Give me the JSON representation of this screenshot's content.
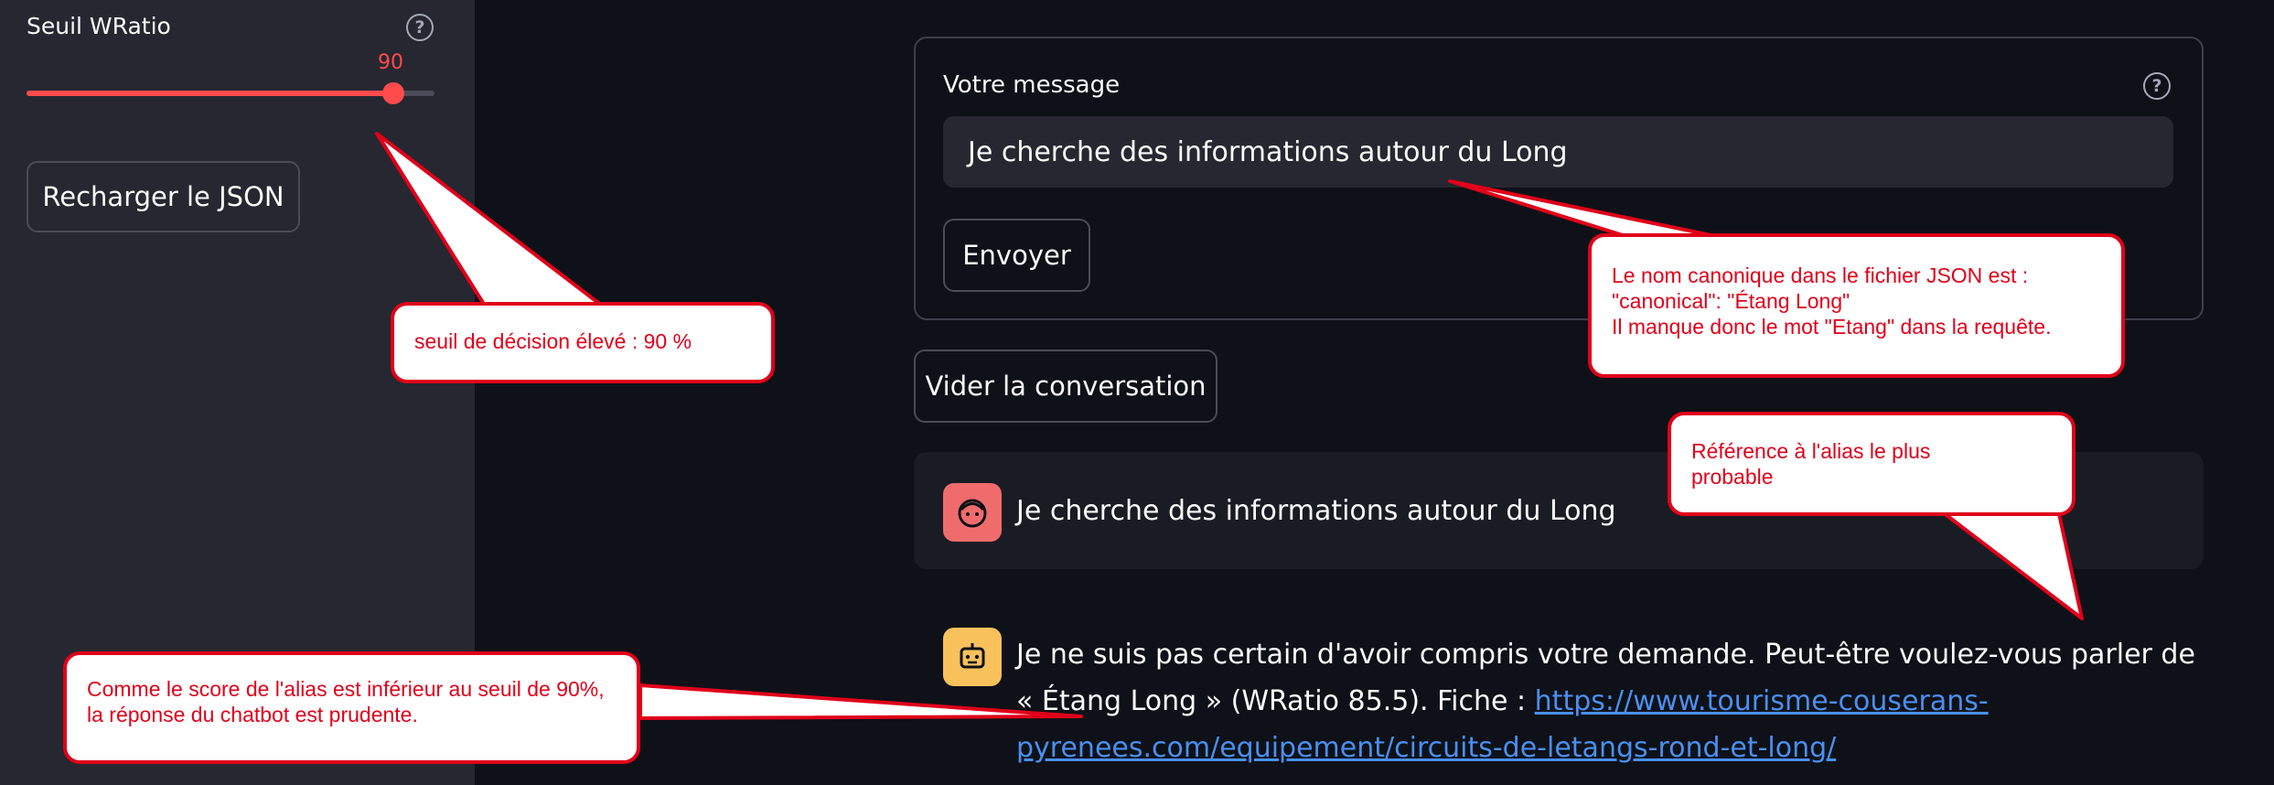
{
  "sidebar": {
    "slider_label": "Seuil WRatio",
    "slider_value": "90",
    "slider_fraction": 0.9,
    "help_glyph": "?",
    "reload_button": "Recharger le JSON"
  },
  "form": {
    "label": "Votre message",
    "help_glyph": "?",
    "input_value": "Je cherche des informations autour du Long",
    "send_button": "Envoyer"
  },
  "clear_button": "Vider la conversation",
  "chat": {
    "user_message": "Je cherche des informations autour du Long",
    "user_avatar_color": "#f06c6c",
    "assistant_message_prefix": "Je ne suis pas certain d'avoir compris votre demande. Peut-être voulez-vous parler de « Étang Long » (WRatio 85.5). Fiche : ",
    "assistant_link": "https://www.tourisme-couserans-pyrenees.com/equipement/circuits-de-letangs-rond-et-long/",
    "assistant_avatar_color": "#f8c15c"
  },
  "annotations": {
    "threshold": "seuil de décision élevé : 90 %",
    "canonical_line1": "Le nom canonique dans le fichier JSON est :",
    "canonical_line2": "\"canonical\": \"Étang Long\"",
    "canonical_line3": "Il manque donc le mot \"Etang\" dans la requête.",
    "alias_reference": "Référence à l'alias le plus probable",
    "score_note": "Comme le score de l'alias est inférieur au seuil de 90%, la réponse du chatbot est prudente."
  },
  "colors": {
    "accent": "#ff4b4b",
    "annotation_red": "#e0001a",
    "link": "#4a8ff0",
    "background": "#0e1117",
    "sidebar": "#262730"
  }
}
